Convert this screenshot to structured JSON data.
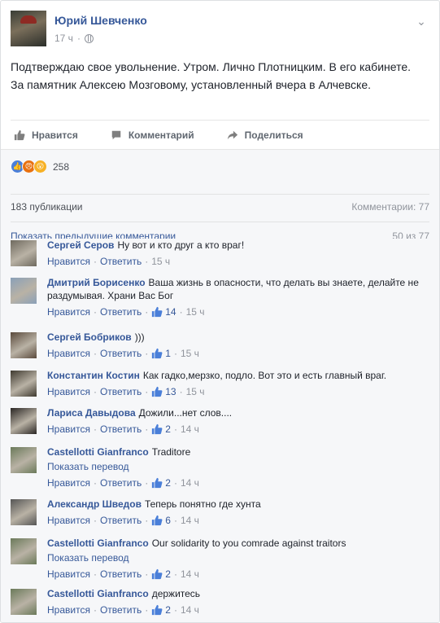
{
  "post": {
    "author": "Юрий Шевченко",
    "time": "17 ч",
    "text": "Подтверждаю свое увольнение. Утром. Лично Плотницким. В его кабинете. За памятник Алексею Мозговому, установленный вчера в Алчевске."
  },
  "actions": {
    "like": "Нравится",
    "comment": "Комментарий",
    "share": "Поделиться"
  },
  "reactions": {
    "count": "258",
    "icons": [
      "like-reaction-icon",
      "angry-reaction-icon",
      "wow-reaction-icon"
    ]
  },
  "stats": {
    "shares": "183 публикации",
    "comments": "Комментарии: 77"
  },
  "prev": {
    "link": "Показать предыдущие комментарии",
    "count": "50 из 77"
  },
  "comments": [
    {
      "name": "Сергей Серов",
      "text": "Ну вот и кто друг а кто враг!",
      "like": "Нравится",
      "reply": "Ответить",
      "likes": "",
      "time": "15 ч",
      "translate": "",
      "avatar_color": "#6f6a5f"
    },
    {
      "name": "Дмитрий Борисенко",
      "text": "Ваша жизнь в опасности, что делать вы знаете, делайте не раздумывая. Храни Вас Бог",
      "like": "Нравится",
      "reply": "Ответить",
      "likes": "14",
      "time": "15 ч",
      "translate": "",
      "avatar_color": "#8aa0b8"
    },
    {
      "name": "Сергей Бобриков",
      "text": ")))",
      "like": "Нравится",
      "reply": "Ответить",
      "likes": "1",
      "time": "15 ч",
      "translate": "",
      "avatar_color": "#5a4a3c"
    },
    {
      "name": "Константин Костин",
      "text": "Как гадко,мерзко, подло. Вот это и есть главный враг.",
      "like": "Нравится",
      "reply": "Ответить",
      "likes": "13",
      "time": "15 ч",
      "translate": "",
      "avatar_color": "#3f3a30"
    },
    {
      "name": "Лариса Давыдова",
      "text": "Дожили...нет слов....",
      "like": "Нравится",
      "reply": "Ответить",
      "likes": "2",
      "time": "14 ч",
      "translate": "",
      "avatar_color": "#2a2624"
    },
    {
      "name": "Castellotti Gianfranco",
      "text": "Traditore",
      "like": "Нравится",
      "reply": "Ответить",
      "likes": "2",
      "time": "14 ч",
      "translate": "Показать перевод",
      "avatar_color": "#6b7a5a"
    },
    {
      "name": "Александр Шведов",
      "text": "Теперь понятно где хунта",
      "like": "Нравится",
      "reply": "Ответить",
      "likes": "6",
      "time": "14 ч",
      "translate": "",
      "avatar_color": "#555555"
    },
    {
      "name": "Castellotti Gianfranco",
      "text": "Our solidarity to you comrade against traitors",
      "like": "Нравится",
      "reply": "Ответить",
      "likes": "2",
      "time": "14 ч",
      "translate": "Показать перевод",
      "avatar_color": "#6b7a5a"
    },
    {
      "name": "Castellotti Gianfranco",
      "text": "держитесь",
      "like": "Нравится",
      "reply": "Ответить",
      "likes": "2",
      "time": "14 ч",
      "translate": "",
      "avatar_color": "#6b7a5a"
    }
  ]
}
